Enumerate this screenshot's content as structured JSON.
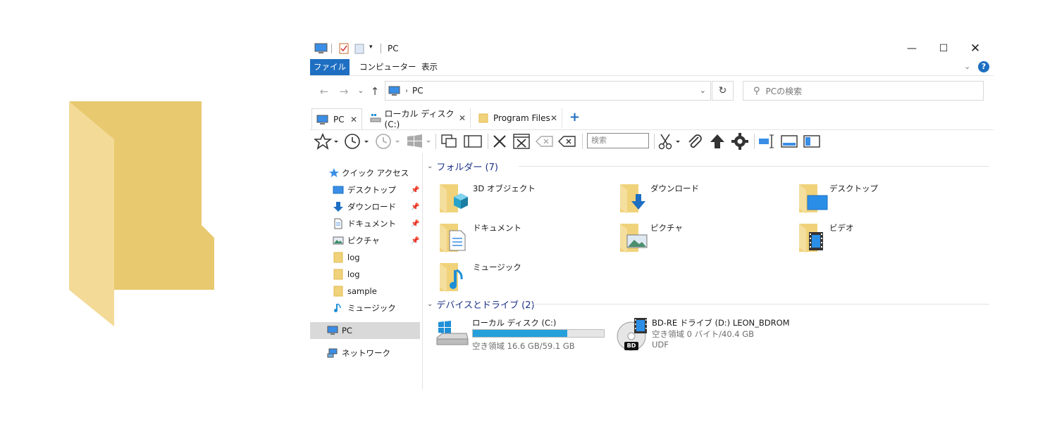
{
  "window": {
    "title": "PC"
  },
  "ribbon": {
    "tabs": [
      "ファイル",
      "コンピューター",
      "表示"
    ]
  },
  "address": {
    "path": "PC"
  },
  "search": {
    "placeholder": "PCの検索"
  },
  "tabs": [
    {
      "label": "PC"
    },
    {
      "label": "ローカル ディスク (C:)"
    },
    {
      "label": "Program Files"
    }
  ],
  "toolbar": {
    "search_placeholder": "検索"
  },
  "nav": {
    "quick_access": "クイック アクセス",
    "items": [
      {
        "label": "デスクトップ",
        "pinned": true
      },
      {
        "label": "ダウンロード",
        "pinned": true
      },
      {
        "label": "ドキュメント",
        "pinned": true
      },
      {
        "label": "ピクチャ",
        "pinned": true
      },
      {
        "label": "log",
        "pinned": false
      },
      {
        "label": "log",
        "pinned": false
      },
      {
        "label": "sample",
        "pinned": false
      },
      {
        "label": "ミュージック",
        "pinned": false
      }
    ],
    "pc": "PC",
    "network": "ネットワーク"
  },
  "content": {
    "folders_header": "フォルダー (7)",
    "folders": [
      {
        "label": "3D オブジェクト",
        "icon": "cube-icon"
      },
      {
        "label": "ダウンロード",
        "icon": "download-arrow-icon"
      },
      {
        "label": "デスクトップ",
        "icon": "desktop-icon"
      },
      {
        "label": "ドキュメント",
        "icon": "document-icon"
      },
      {
        "label": "ピクチャ",
        "icon": "picture-icon"
      },
      {
        "label": "ビデオ",
        "icon": "film-icon"
      },
      {
        "label": "ミュージック",
        "icon": "music-note-icon"
      }
    ],
    "devices_header": "デバイスとドライブ (2)",
    "drives": [
      {
        "label": "ローカル ディスク (C:)",
        "free": "空き領域 16.6 GB/59.1 GB",
        "used_fraction": 0.72
      },
      {
        "label": "BD-RE ドライブ (D:) LEON_BDROM",
        "free": "空き領域 0 バイト/40.4 GB",
        "fs": "UDF",
        "badge": "BD"
      }
    ]
  },
  "colors": {
    "accent": "#1e6fc2",
    "folder": "#f0d27a",
    "folder_dark": "#e2b94f",
    "header_text": "#1e3287",
    "bar_fill": "#26a0da"
  }
}
